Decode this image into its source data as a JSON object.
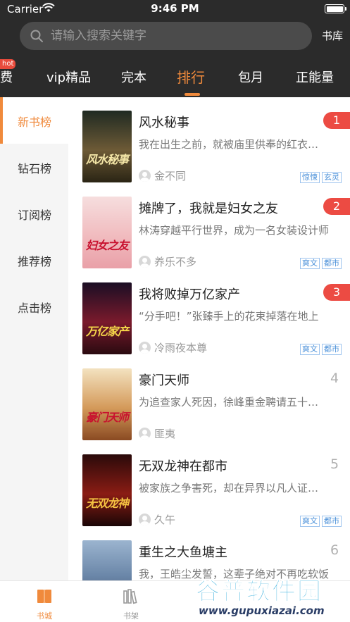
{
  "status": {
    "carrier": "Carrier",
    "time": "9:46 PM"
  },
  "search": {
    "placeholder": "请输入搜索关键字"
  },
  "header": {
    "library_label": "书库"
  },
  "categories": [
    {
      "label": "费",
      "badge": "hot"
    },
    {
      "label": "vip精品"
    },
    {
      "label": "完本"
    },
    {
      "label": "排行",
      "active": true
    },
    {
      "label": "包月"
    },
    {
      "label": "正能量"
    }
  ],
  "side_nav": [
    {
      "label": "新书榜",
      "active": true
    },
    {
      "label": "钻石榜"
    },
    {
      "label": "订阅榜"
    },
    {
      "label": "推荐榜"
    },
    {
      "label": "点击榜"
    }
  ],
  "books": [
    {
      "rank": "1",
      "title": "风水秘事",
      "desc": "我在出生之前，就被庙里供奉的红衣娘娘看中",
      "author": "金不同",
      "tags": [
        "惊悚",
        "玄灵"
      ],
      "cover_text": "风水秘事",
      "cover_color": "#5a4a2e"
    },
    {
      "rank": "2",
      "title": "摊牌了，我就是妇女之友",
      "desc": "林涛穿越平行世界，成为一名女装设计师",
      "author": "养乐不多",
      "tags": [
        "爽文",
        "都市"
      ],
      "cover_text": "妇女之友",
      "cover_color": "#f2c6c8"
    },
    {
      "rank": "3",
      "title": "我将败掉万亿家产",
      "desc": "“分手吧！”张臻手上的花束掉落在地上",
      "author": "冷雨夜本尊",
      "tags": [
        "爽文",
        "都市"
      ],
      "cover_text": "万亿家产",
      "cover_color": "#6b1e2a"
    },
    {
      "rank": "4",
      "title": "豪门天师",
      "desc": "为追查家人死因，徐峰重金聘请五十位大师",
      "author": "匪夷",
      "tags": [],
      "cover_text": "豪门天师",
      "cover_color": "#d4a66a"
    },
    {
      "rank": "5",
      "title": "无双龙神在都市",
      "desc": "被家族之争害死，却在异界以凡人证道成神",
      "author": "久午",
      "tags": [
        "爽文",
        "都市"
      ],
      "cover_text": "无双龙神",
      "cover_color": "#3a1414"
    },
    {
      "rank": "6",
      "title": "重生之大鱼塘主",
      "desc": "我，王皓尘发誓，这辈子绝对不再吃软饭",
      "author": "",
      "tags": [],
      "cover_text": "",
      "cover_color": "#6a86a8"
    }
  ],
  "tabbar": [
    {
      "label": "书城",
      "active": true
    },
    {
      "label": "书架"
    }
  ],
  "watermark": {
    "text": "谷普软件园",
    "url": "www.gupuxiazai.com"
  },
  "colors": {
    "accent": "#f08a3c",
    "rank_badge": "#ec4b43",
    "header_bg": "#2b2b2b",
    "tag": "#4a90d9"
  }
}
